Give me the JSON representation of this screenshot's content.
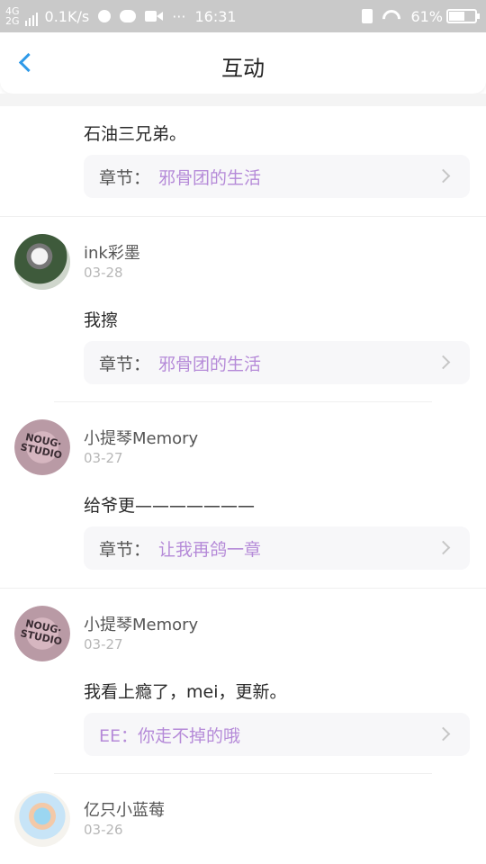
{
  "status_bar": {
    "network_top": "4G",
    "network_bottom": "2G",
    "speed": "0.1K/s",
    "more": "···",
    "time": "16:31",
    "battery": "61%",
    "battery_level": 0.61
  },
  "header": {
    "title": "互动"
  },
  "comments": [
    {
      "text": "石油三兄弟。",
      "chapter_label": "章节：",
      "chapter": "邪骨团的生活"
    },
    {
      "user": "ink彩墨",
      "date": "03-28",
      "text": "我擦",
      "chapter_label": "章节：",
      "chapter": "邪骨团的生活"
    },
    {
      "user": "小提琴Memory",
      "date": "03-27",
      "avatar_text": "NOUG· STUDIO",
      "text": "给爷更———————",
      "chapter_label": "章节：",
      "chapter": "让我再鸽一章"
    },
    {
      "user": "小提琴Memory",
      "date": "03-27",
      "avatar_text": "NOUG· STUDIO",
      "text": "我看上瘾了，mei，更新。",
      "reply": "EE：你走不掉的哦"
    },
    {
      "user": "亿只小蓝莓",
      "date": "03-26"
    }
  ],
  "colors": {
    "accent": "#2f9ae8",
    "chapter_link": "#b58ad8"
  }
}
